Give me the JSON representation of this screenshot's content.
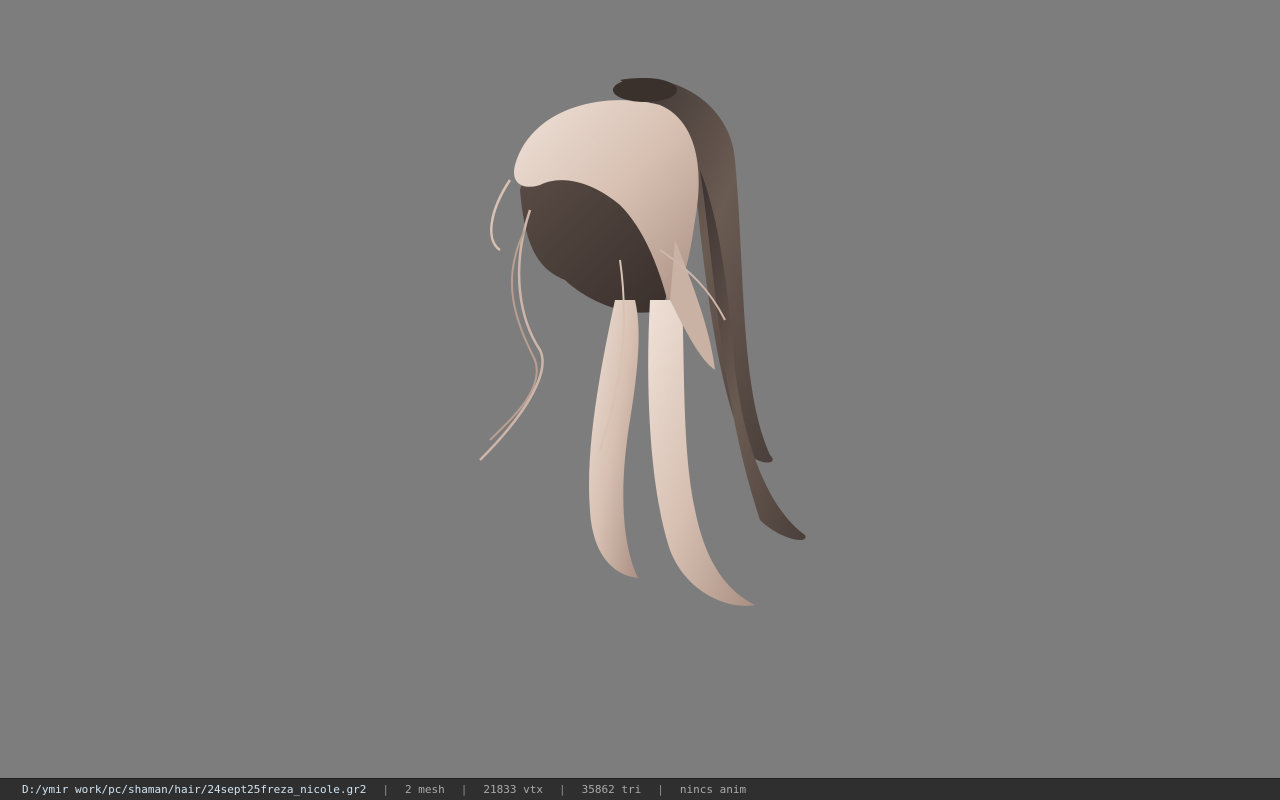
{
  "viewport": {
    "background": "#7d7d7d",
    "model_icon": "hair-mesh-render"
  },
  "statusbar": {
    "file_path": "D:/ymir work/pc/shaman/hair/24sept25freza_nicole.gr2",
    "separator": "|",
    "mesh_count": "2 mesh",
    "vertex_count": "21833 vtx",
    "triangle_count": "35862 tri",
    "anim_status": "nincs anim"
  },
  "colors": {
    "hair_light": "#d8c2b4",
    "hair_dark": "#5a4e48",
    "scalp": "#4a3f3a",
    "statusbar_bg": "#2f2f2f",
    "path_text": "#cfe1ef"
  }
}
